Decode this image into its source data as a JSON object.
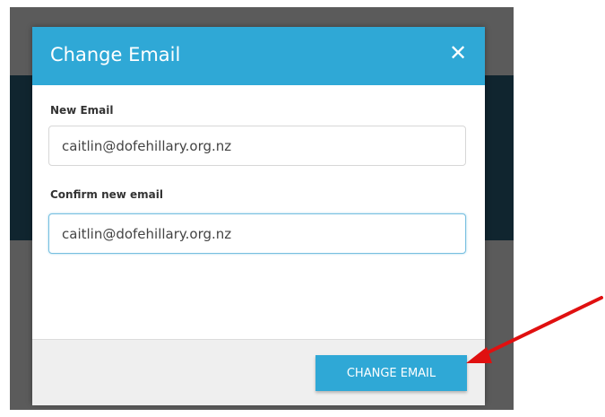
{
  "dialog": {
    "title": "Change Email",
    "close_icon": "close-icon",
    "close_glyph": "✕",
    "header_color": "#2fa8d6"
  },
  "form": {
    "new_email_label": "New Email",
    "new_email_value": "caitlin@dofehillary.org.nz",
    "confirm_email_label": "Confirm new email",
    "confirm_email_value": "caitlin@dofehillary.org.nz"
  },
  "footer": {
    "submit_label": "CHANGE EMAIL"
  },
  "annotation": {
    "arrow_color": "#e01010"
  }
}
